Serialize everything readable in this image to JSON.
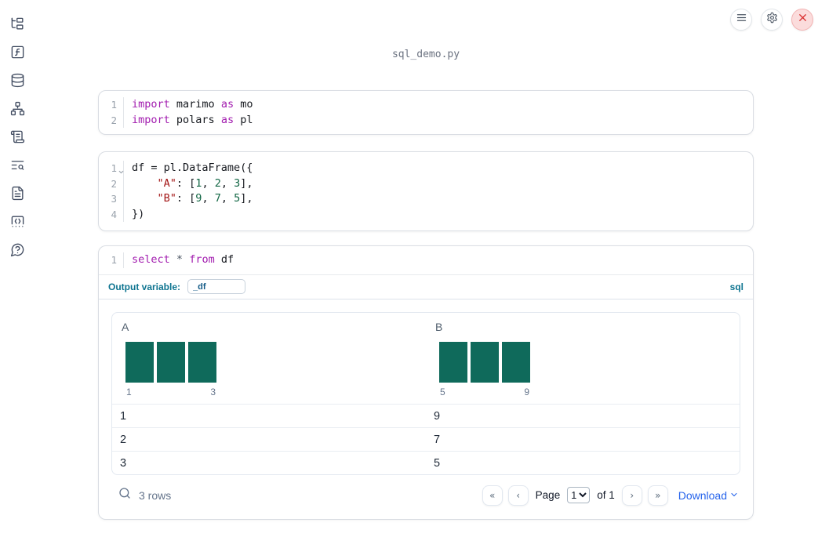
{
  "titlebar": {
    "filename": "sql_demo.py",
    "buttons": [
      {
        "icon": "menu-icon"
      },
      {
        "icon": "settings-gear-icon"
      },
      {
        "icon": "shutdown-close-icon"
      }
    ]
  },
  "sidebar": {
    "items": [
      {
        "icon": "file-explorer-tree-icon"
      },
      {
        "icon": "variables-function-icon"
      },
      {
        "icon": "datasources-database-icon"
      },
      {
        "icon": "dependency-graph-icon"
      },
      {
        "icon": "logs-scroll-icon"
      },
      {
        "icon": "outline-search-icon"
      },
      {
        "icon": "documentation-file-icon"
      },
      {
        "icon": "snippets-code-icon"
      },
      {
        "icon": "help-chat-icon"
      }
    ]
  },
  "cells": [
    {
      "type": "python",
      "lines": [
        {
          "n": "1",
          "fold": false,
          "tokens": [
            [
              "kw",
              "import"
            ],
            [
              "pl",
              " marimo "
            ],
            [
              "kw",
              "as"
            ],
            [
              "pl",
              " mo"
            ]
          ]
        },
        {
          "n": "2",
          "fold": false,
          "tokens": [
            [
              "kw",
              "import"
            ],
            [
              "pl",
              " polars "
            ],
            [
              "kw",
              "as"
            ],
            [
              "pl",
              " pl"
            ]
          ]
        }
      ]
    },
    {
      "type": "python",
      "lines": [
        {
          "n": "1",
          "fold": true,
          "tokens": [
            [
              "pl",
              "df = pl.DataFrame({"
            ]
          ]
        },
        {
          "n": "2",
          "fold": false,
          "tokens": [
            [
              "pl",
              "    "
            ],
            [
              "str",
              "\"A\""
            ],
            [
              "pl",
              ": ["
            ],
            [
              "num",
              "1"
            ],
            [
              "pl",
              ", "
            ],
            [
              "num",
              "2"
            ],
            [
              "pl",
              ", "
            ],
            [
              "num",
              "3"
            ],
            [
              "pl",
              "],"
            ]
          ]
        },
        {
          "n": "3",
          "fold": false,
          "tokens": [
            [
              "pl",
              "    "
            ],
            [
              "str",
              "\"B\""
            ],
            [
              "pl",
              ": ["
            ],
            [
              "num",
              "9"
            ],
            [
              "pl",
              ", "
            ],
            [
              "num",
              "7"
            ],
            [
              "pl",
              ", "
            ],
            [
              "num",
              "5"
            ],
            [
              "pl",
              "],"
            ]
          ]
        },
        {
          "n": "4",
          "fold": false,
          "tokens": [
            [
              "pl",
              "})"
            ]
          ]
        }
      ]
    },
    {
      "type": "sql",
      "lines": [
        {
          "n": "1",
          "fold": false,
          "tokens": [
            [
              "kw",
              "select"
            ],
            [
              "pl",
              " "
            ],
            [
              "op",
              "*"
            ],
            [
              "pl",
              " "
            ],
            [
              "kw",
              "from"
            ],
            [
              "pl",
              " df"
            ]
          ]
        }
      ]
    }
  ],
  "sql_cell": {
    "output_variable_label": "Output variable:",
    "output_variable_value": "_df",
    "language_badge": "sql"
  },
  "table": {
    "columns": [
      {
        "name": "A",
        "histogram": {
          "bar_count": 3,
          "bar_values": [
            1,
            1,
            1
          ],
          "min_label": "1",
          "max_label": "3"
        }
      },
      {
        "name": "B",
        "histogram": {
          "bar_count": 3,
          "bar_values": [
            1,
            1,
            1
          ],
          "min_label": "5",
          "max_label": "9"
        }
      }
    ],
    "rows": [
      [
        "1",
        "9"
      ],
      [
        "2",
        "7"
      ],
      [
        "3",
        "5"
      ]
    ],
    "footer": {
      "row_count_text": "3 rows",
      "first_page_glyph": "«",
      "prev_page_glyph": "‹",
      "page_label": "Page",
      "page_value": "1",
      "of_label": "of 1",
      "next_page_glyph": "›",
      "last_page_glyph": "»",
      "download_label": "Download"
    }
  },
  "colors": {
    "histogram_bar": "#0f6a5b",
    "accent_blue": "#2563eb",
    "sql_label_teal": "#0e7490",
    "keyword": "#a21caf",
    "string": "#a31515",
    "number": "#116644",
    "close_red": "#d92d2d"
  }
}
